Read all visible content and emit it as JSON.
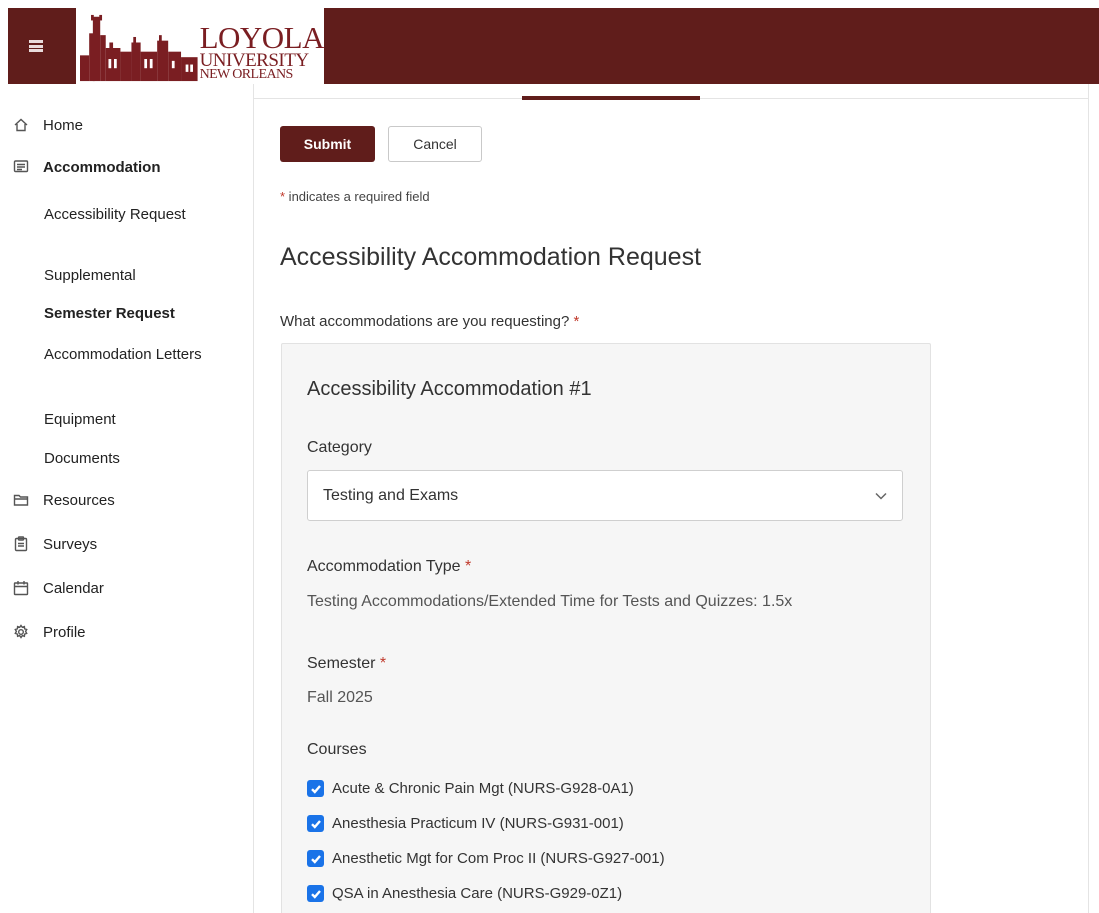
{
  "header": {
    "logo": {
      "line1": "LOYOLA",
      "line2": "UNIVERSITY",
      "line3": "NEW ORLEANS"
    }
  },
  "sidebar": {
    "home": "Home",
    "accommodation": "Accommodation",
    "sub": {
      "accessibility_request": "Accessibility Request",
      "supplemental": "Supplemental",
      "semester_request": "Semester Request",
      "accommodation_letters": "Accommodation Letters",
      "equipment": "Equipment",
      "documents": "Documents"
    },
    "resources": "Resources",
    "surveys": "Surveys",
    "calendar": "Calendar",
    "profile": "Profile"
  },
  "form": {
    "submit_label": "Submit",
    "cancel_label": "Cancel",
    "required_note_star": "*",
    "required_note": " indicates a required field",
    "title": "Accessibility Accommodation Request",
    "question": "What accommodations are you requesting? ",
    "required_star": "*",
    "card": {
      "title": "Accessibility Accommodation #1",
      "category_label": "Category",
      "category_value": "Testing and Exams",
      "type_label": "Accommodation Type ",
      "type_value": "Testing Accommodations/Extended Time for Tests and Quizzes: 1.5x",
      "semester_label": "Semester ",
      "semester_value": "Fall 2025",
      "courses_label": "Courses",
      "courses": [
        "Acute & Chronic Pain Mgt (NURS-G928-0A1)",
        "Anesthesia Practicum IV (NURS-G931-001)",
        "Anesthetic Mgt for Com Proc II (NURS-G927-001)",
        "QSA in Anesthesia Care (NURS-G929-0Z1)"
      ]
    }
  },
  "colors": {
    "brand": "#601d1b",
    "checkbox": "#1a73e8",
    "required": "#c0392b"
  }
}
